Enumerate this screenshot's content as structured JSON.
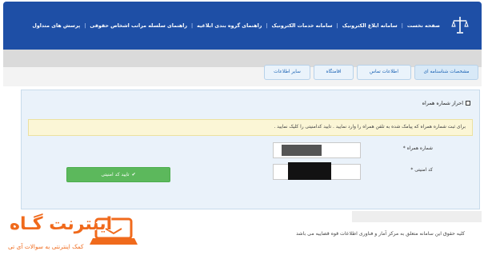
{
  "header": {
    "nav_items": [
      "صفحه نخست",
      "سامانه ابلاغ الکترونیک",
      "سامانه خدمات الکترونیک",
      "راهنمای گروه بندی ابلاغیه",
      "راهنمای سلسله مراتب اشخاص حقوقی",
      "پرسش های متداول"
    ],
    "logo_icon": "scales-of-justice-icon"
  },
  "tabs": [
    "مشخصات شناسنامه ای",
    "اطلاعات تماس",
    "اقامتگاه",
    "سایر اطلاعات"
  ],
  "panel": {
    "title": "احراز شماره همراه",
    "alert": "برای ثبت شماره همراه که پیامک شده به تلفن همراه را وارد نمایید . تایید کدامنیتی را کلیک نمایید .",
    "mobile_label": "شماره همراه",
    "code_label": "کد امنیتی",
    "required_mark": "*",
    "confirm_button": "تایید کد امنیتی"
  },
  "footer": {
    "copyright": "کلیه حقوق این سامانه متعلق به مرکز آمار و فناوری اطلاعات قوه قضاییه می باشد"
  },
  "watermark": {
    "title": "اینترنت گـاه",
    "subtitle": "کمک اینترنتی به سوالات آی تی"
  },
  "colors": {
    "navbar": "#1e4fa6",
    "tab_text": "#1b63b4",
    "button": "#5cb85c",
    "alert_bg": "#fbf6d6",
    "watermark": "#f06a1c"
  }
}
